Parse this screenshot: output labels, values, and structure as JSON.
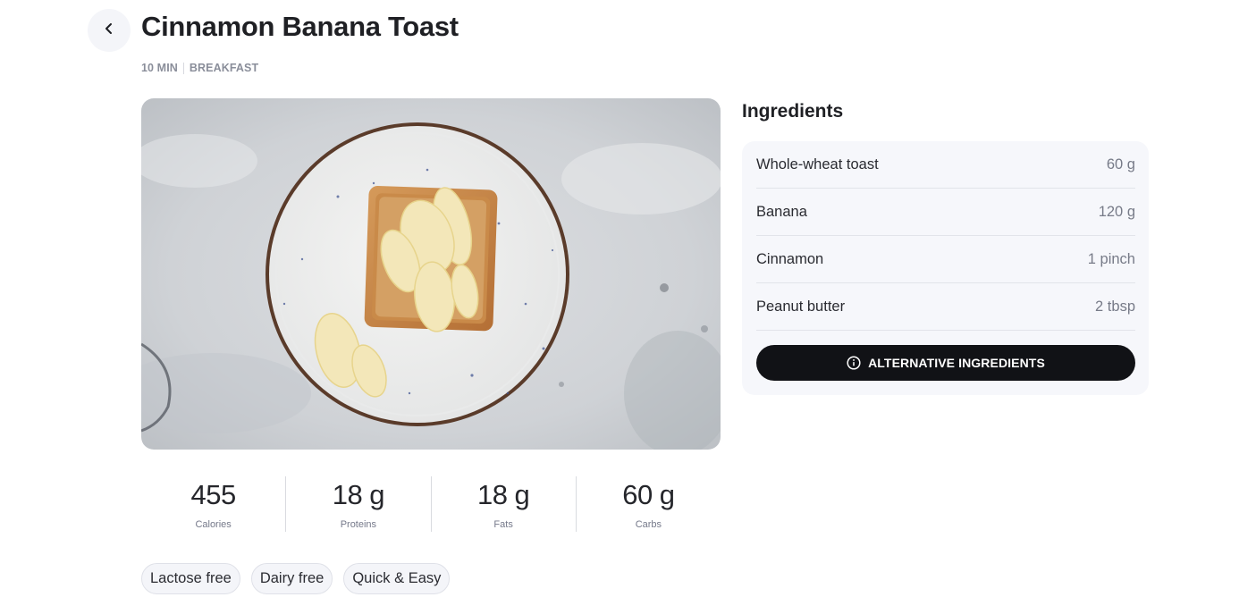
{
  "recipe": {
    "title": "Cinnamon Banana Toast",
    "duration": "10 MIN",
    "category": "BREAKFAST"
  },
  "nutrition": [
    {
      "value": "455",
      "label": "Calories"
    },
    {
      "value": "18 g",
      "label": "Proteins"
    },
    {
      "value": "18 g",
      "label": "Fats"
    },
    {
      "value": "60 g",
      "label": "Carbs"
    }
  ],
  "tags": [
    "Lactose free",
    "Dairy free",
    "Quick & Easy"
  ],
  "ingredients": {
    "heading": "Ingredients",
    "items": [
      {
        "name": "Whole-wheat toast",
        "qty": "60 g"
      },
      {
        "name": "Banana",
        "qty": "120 g"
      },
      {
        "name": "Cinnamon",
        "qty": "1 pinch"
      },
      {
        "name": "Peanut butter",
        "qty": "2 tbsp"
      }
    ],
    "alt_button_label": "ALTERNATIVE INGREDIENTS"
  },
  "icons": {
    "back": "chevron-left-icon",
    "info": "info-icon"
  },
  "colors": {
    "button_bg": "#111216",
    "card_bg": "#f6f7fb",
    "muted_text": "#8a8e9a"
  }
}
